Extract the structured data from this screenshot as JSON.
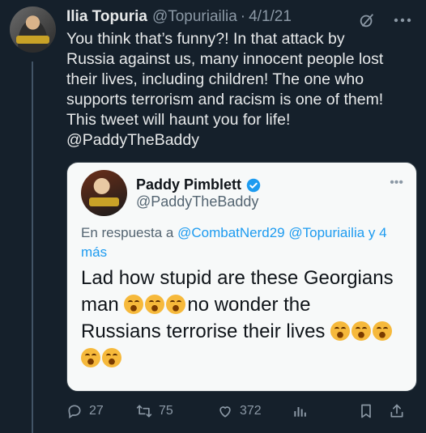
{
  "tweet": {
    "author_name": "Ilia Topuria",
    "handle": "@Topuriailia",
    "separator": "·",
    "date": "4/1/21",
    "text": "You think that’s funny?! In that attack by\nRussia against us, many innocent people lost\ntheir lives, including children! The one who\nsupports terrorism and racism is one of them!\nThis tweet will haunt you for life!\n@PaddyTheBaddy"
  },
  "quote": {
    "author_name": "Paddy Pimblett",
    "handle": "@PaddyTheBaddy",
    "reply_prefix": "En respuesta a",
    "reply_mentions": [
      "@CombatNerd29",
      "@Topuriailia"
    ],
    "reply_suffix": "y 4 más",
    "text_line1": "Lad how stupid are these Georgians",
    "text_man": "man",
    "text_after_emojis": "no wonder the",
    "text_line3": "Russians terrorise their lives",
    "more_label": "•••"
  },
  "actions": {
    "replies": "27",
    "retweets": "75",
    "likes": "372"
  },
  "colors": {
    "background": "#15202b",
    "text": "#e7e9ea",
    "secondary": "#8b98a5",
    "accent": "#1d9bf0",
    "quote_bg": "#f7f9f9"
  },
  "icons": [
    "grok-icon",
    "more-icon",
    "verified-icon",
    "reply-icon",
    "retweet-icon",
    "like-icon",
    "views-icon",
    "bookmark-icon",
    "share-icon"
  ]
}
